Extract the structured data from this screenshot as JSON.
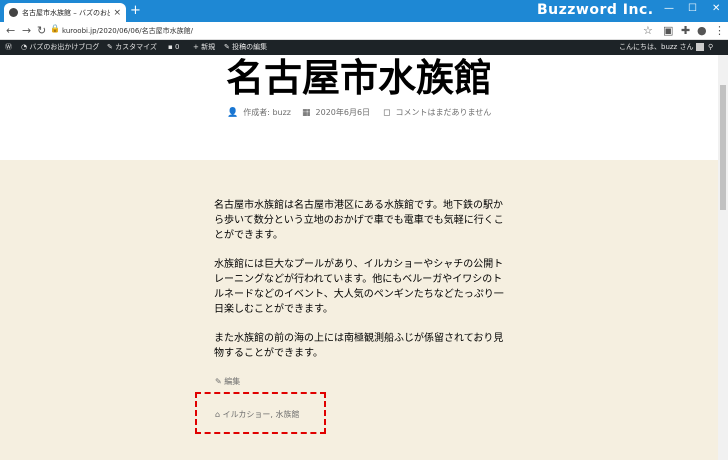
{
  "browser": {
    "tab_title": "名古屋市水族館 – バズのお出かけブ",
    "tab_close": "×",
    "new_tab": "+",
    "brand": "Buzzword Inc.",
    "window_controls": [
      "—",
      "☐",
      "✕"
    ],
    "url": "kuroobi.jp/2020/06/06/名古屋市水族館/"
  },
  "adminbar": {
    "items": [
      "バズのお出かけブログ",
      "カスタマイズ",
      "0",
      "新規",
      "投稿の編集"
    ],
    "greeting": "こんにちは、buzz さん"
  },
  "post": {
    "title": "名古屋市水族館",
    "author": "作成者: buzz",
    "date": "2020年6月6日",
    "comments": "コメントはまだありません",
    "paragraphs": [
      "名古屋市水族館は名古屋市港区にある水族館です。地下鉄の駅から歩いて数分という立地のおかげで車でも電車でも気軽に行くことができます。",
      "水族館には巨大なプールがあり、イルカショーやシャチの公開トレーニングなどが行われています。他にもベルーガやイワシのトルネードなどのイベント、大人気のペンギンたちなどたっぷり一日楽しむことができます。",
      "また水族館の前の海の上には南極観測船ふじが係留されており見物することができます。"
    ],
    "edit_label": "編集",
    "tags": "イルカショー, 水族館"
  }
}
